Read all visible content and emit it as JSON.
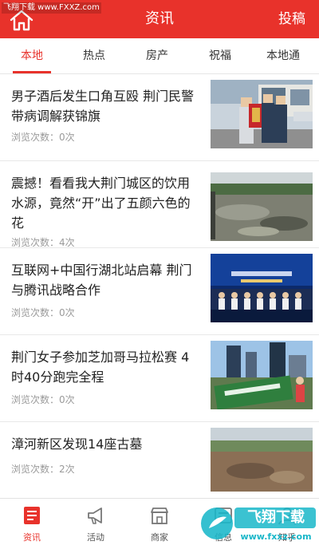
{
  "watermark_top": "飞翔下载 www.FXXZ.com",
  "header": {
    "title": "资讯",
    "post_label": "投稿"
  },
  "tabs": [
    "本地",
    "热点",
    "房产",
    "祝福",
    "本地通"
  ],
  "articles": [
    {
      "title": "男子酒后发生口角互殴 荆门民警带病调解获锦旗",
      "views": "浏览次数：0次"
    },
    {
      "title": "震撼！看看我大荆门城区的饮用水源，竟然“开”出了五颜六色的花",
      "views": "浏览次数：4次"
    },
    {
      "title": "互联网+中国行湖北站启幕 荆门与腾讯战略合作",
      "views": "浏览次数：0次"
    },
    {
      "title": "荆门女子参加芝加哥马拉松赛 4时40分跑完全程",
      "views": "浏览次数：0次"
    },
    {
      "title": "漳河新区发现14座古墓",
      "views": "浏览次数：2次"
    }
  ],
  "tabbar": [
    {
      "label": "资讯",
      "icon": "news-icon"
    },
    {
      "label": "活动",
      "icon": "megaphone-icon"
    },
    {
      "label": "商家",
      "icon": "shop-icon"
    },
    {
      "label": "信息",
      "icon": "info-icon"
    },
    {
      "label": "知乎",
      "icon": "user-icon"
    }
  ],
  "watermark_bottom": {
    "brand": "飞翔下载",
    "url": "www.fxxz.com"
  },
  "colors": {
    "accent": "#e8322b"
  }
}
